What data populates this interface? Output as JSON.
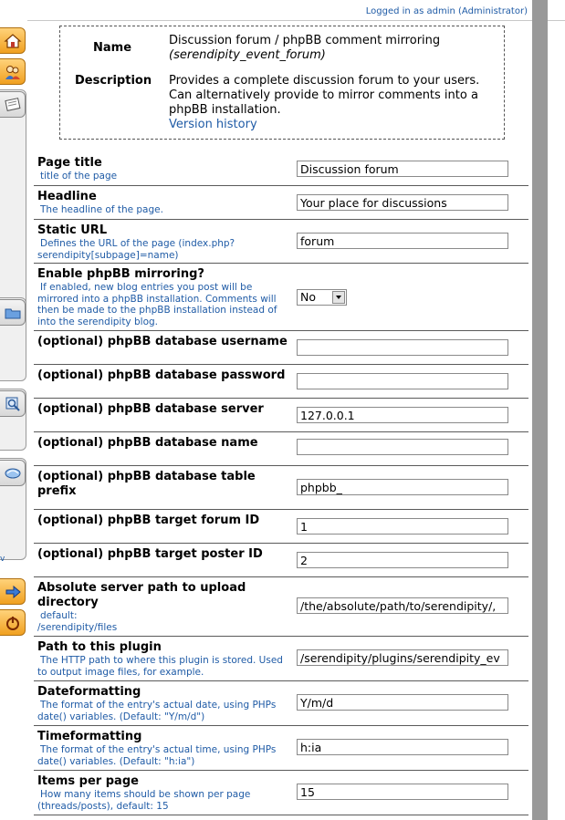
{
  "header": {
    "logged_in_prefix": "Logged in as",
    "username": "admin",
    "role": "(Administrator)"
  },
  "sidebar": {
    "icons": [
      "home-icon",
      "users-icon",
      "entries-icon",
      "folder-icon",
      "image-icon",
      "plugin-icon",
      "arrow-right-icon",
      "power-icon"
    ],
    "stray_text": "v"
  },
  "plugin_info": {
    "name_label": "Name",
    "name_value": "Discussion forum / phpBB comment mirroring",
    "name_id": "(serendipity_event_forum)",
    "description_label": "Description",
    "description_value": "Provides a complete discussion forum to your users. Can alternatively provide to mirror comments into a phpBB installation.",
    "version_link": "Version history"
  },
  "fields": [
    {
      "title": "Page title",
      "desc": "title of the page",
      "value": "Discussion forum"
    },
    {
      "title": "Headline",
      "desc": "The headline of the page.",
      "value": "Your place for discussions"
    },
    {
      "title": "Static URL",
      "desc": "Defines the URL of the page (index.php?serendipity[subpage]=name)",
      "value": "forum"
    },
    {
      "title": "Enable phpBB mirroring?",
      "desc": "If enabled, new blog entries you post will be mirrored into a phpBB installation. Comments will then be made to the phpBB installation instead of into the serendipity blog.",
      "value": "No",
      "type": "select"
    },
    {
      "title": "(optional) phpBB database username",
      "desc": "",
      "value": ""
    },
    {
      "title": "(optional) phpBB database password",
      "desc": "",
      "value": ""
    },
    {
      "title": "(optional) phpBB database server",
      "desc": "",
      "value": "127.0.0.1"
    },
    {
      "title": "(optional) phpBB database name",
      "desc": "",
      "value": ""
    },
    {
      "title": "(optional) phpBB database table prefix",
      "desc": "",
      "value": "phpbb_"
    },
    {
      "title": "(optional) phpBB target forum ID",
      "desc": "",
      "value": "1"
    },
    {
      "title": "(optional) phpBB target poster ID",
      "desc": "",
      "value": "2"
    },
    {
      "title": "Absolute server path to upload directory",
      "desc_line1": "default:",
      "desc_line2": "/serendipity/files",
      "value": "/the/absolute/path/to/serendipity/,"
    },
    {
      "title": "Path to this plugin",
      "desc": "The HTTP path to where this plugin is stored. Used to output image files, for example.",
      "value": "/serendipity/plugins/serendipity_ev"
    },
    {
      "title": "Dateformatting",
      "desc": "The format of the entry's actual date, using PHPs date() variables. (Default: \"Y/m/d\")",
      "value": "Y/m/d"
    },
    {
      "title": "Timeformatting",
      "desc": "The format of the entry's actual time, using PHPs date() variables. (Default: \"h:ia\")",
      "value": "h:ia"
    },
    {
      "title": "Items per page",
      "desc": "How many items should be shown per page (threads/posts), default: 15",
      "value": "15"
    }
  ]
}
